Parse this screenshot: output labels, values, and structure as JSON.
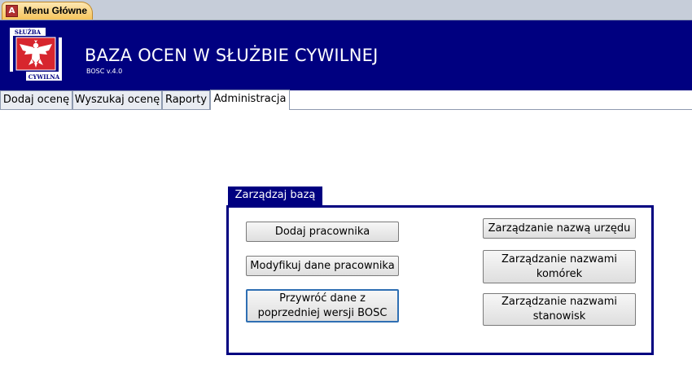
{
  "document_tab": {
    "label": "Menu Główne",
    "icon": "access-app-icon"
  },
  "header": {
    "title": "BAZA OCEN W SŁUŻBIE CYWILNEJ",
    "version": "BOSC v.4.0",
    "emblem": {
      "icon": "civil-service-eagle-logo",
      "top_text": "SŁUŻBA",
      "bottom_text": "CYWILNA"
    },
    "background": "#000080"
  },
  "tabs": [
    {
      "label": "Dodaj ocenę"
    },
    {
      "label": "Wyszukaj ocenę"
    },
    {
      "label": "Raporty"
    },
    {
      "label": "Administracja",
      "active": true
    }
  ],
  "group": {
    "title": "Zarządzaj bazą",
    "left_buttons": [
      {
        "label": "Dodaj pracownika"
      },
      {
        "label": "Modyfikuj dane pracownika"
      },
      {
        "label": "Przywróć dane z poprzedniej wersji BOSC",
        "focused": true
      }
    ],
    "right_buttons": [
      {
        "label": "Zarządzanie nazwą urzędu"
      },
      {
        "label": "Zarządzanie nazwami komórek"
      },
      {
        "label": "Zarządzanie nazwami stanowisk"
      }
    ]
  }
}
